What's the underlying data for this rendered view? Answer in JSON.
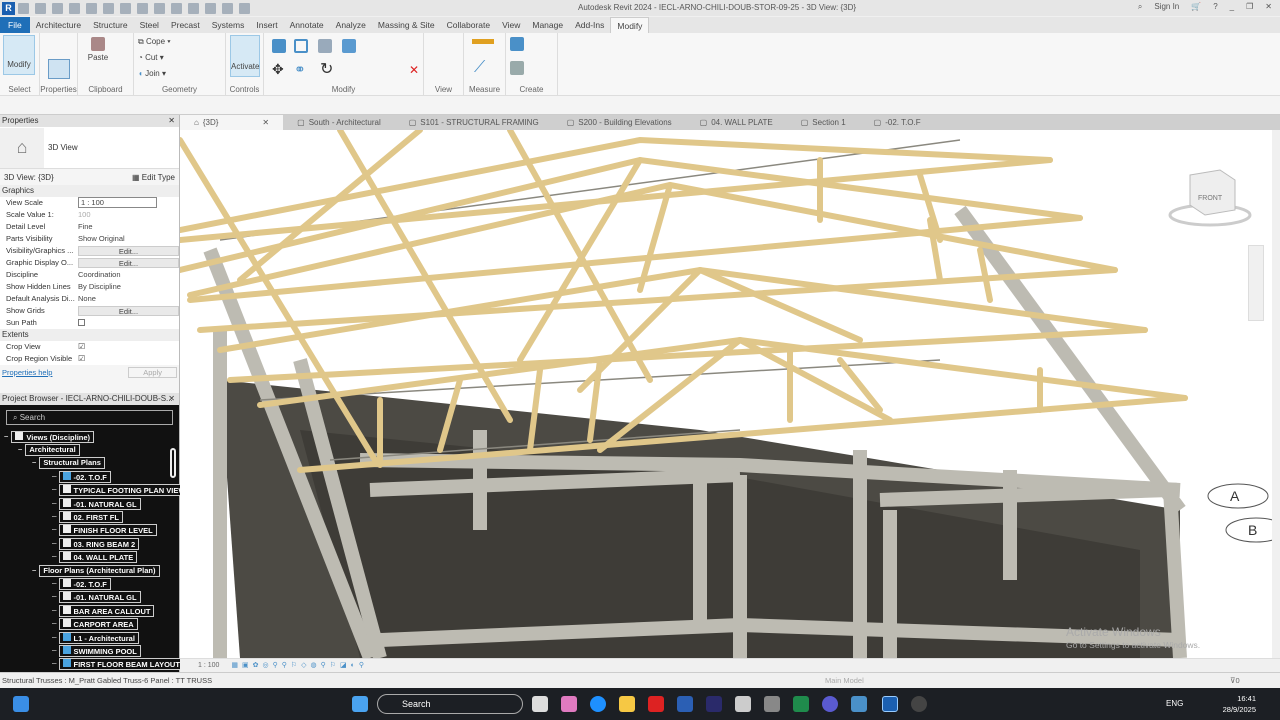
{
  "app": {
    "logo": "R",
    "title": "Autodesk Revit 2024 - IECL-ARNO-CHILI-DOUB-STOR-09-25 - 3D View: {3D}",
    "sign_in": "Sign In"
  },
  "ribbon_tabs": [
    "File",
    "Architecture",
    "Structure",
    "Steel",
    "Precast",
    "Systems",
    "Insert",
    "Annotate",
    "Analyze",
    "Massing & Site",
    "Collaborate",
    "View",
    "Manage",
    "Add-Ins",
    "Modify"
  ],
  "ribbon": {
    "modify": "Modify",
    "paste": "Paste",
    "cope": "Cope",
    "cut": "Cut",
    "join": "Join",
    "activate": "Activate",
    "panels": {
      "select": "Select",
      "properties": "Properties",
      "clipboard": "Clipboard",
      "geometry": "Geometry",
      "controls": "Controls",
      "modify": "Modify",
      "view": "View",
      "measure": "Measure",
      "create": "Create"
    }
  },
  "properties": {
    "header": "Properties",
    "type_name": "3D View",
    "selector": "3D View: {3D}",
    "edit_type": "Edit Type",
    "graphics": "Graphics",
    "extents": "Extents",
    "help": "Properties help",
    "apply": "Apply",
    "rows": [
      [
        "View Scale",
        "1 : 100"
      ],
      [
        "Scale Value    1:",
        "100"
      ],
      [
        "Detail Level",
        "Fine"
      ],
      [
        "Parts Visibility",
        "Show Original"
      ],
      [
        "Visibility/Graphics ...",
        "Edit..."
      ],
      [
        "Graphic Display O...",
        "Edit..."
      ],
      [
        "Discipline",
        "Coordination"
      ],
      [
        "Show Hidden Lines",
        "By Discipline"
      ],
      [
        "Default Analysis Di...",
        "None"
      ],
      [
        "Show Grids",
        "Edit..."
      ],
      [
        "Sun Path",
        ""
      ]
    ],
    "extent_rows": [
      [
        "Crop View",
        "checked"
      ],
      [
        "Crop Region Visible",
        "checked"
      ]
    ]
  },
  "browser": {
    "header": "Project Browser - IECL-ARNO-CHILI-DOUB-S...",
    "search": "Search",
    "nodes": [
      {
        "label": "Views (Discipline)",
        "depth": 0,
        "icon": "folder"
      },
      {
        "label": "Architectural",
        "depth": 1
      },
      {
        "label": "Structural Plans",
        "depth": 2
      },
      {
        "label": "-02. T.O.F",
        "depth": 3,
        "icon": "blue"
      },
      {
        "label": "TYPICAL FOOTING PLAN VIEW",
        "depth": 3,
        "icon": "white"
      },
      {
        "label": "-01. NATURAL GL",
        "depth": 3,
        "icon": "white"
      },
      {
        "label": "02. FIRST FL",
        "depth": 3,
        "icon": "white"
      },
      {
        "label": "FINISH FLOOR LEVEL",
        "depth": 3,
        "icon": "white"
      },
      {
        "label": "03. RING BEAM 2",
        "depth": 3,
        "icon": "white"
      },
      {
        "label": "04. WALL PLATE",
        "depth": 3,
        "icon": "white"
      },
      {
        "label": "Floor Plans (Architectural Plan)",
        "depth": 2
      },
      {
        "label": "-02. T.O.F",
        "depth": 3,
        "icon": "white"
      },
      {
        "label": "-01. NATURAL GL",
        "depth": 3,
        "icon": "white"
      },
      {
        "label": "BAR AREA CALLOUT",
        "depth": 3,
        "icon": "white"
      },
      {
        "label": "CARPORT AREA",
        "depth": 3,
        "icon": "white"
      },
      {
        "label": "L1 - Architectural",
        "depth": 3,
        "icon": "blue"
      },
      {
        "label": "SWIMMING POOL",
        "depth": 3,
        "icon": "blue"
      },
      {
        "label": "FIRST FLOOR BEAM LAYOUT",
        "depth": 3,
        "icon": "blue"
      }
    ]
  },
  "view_tabs": [
    "{3D}",
    "South - Architectural",
    "S101 - STRUCTURAL FRAMING",
    "S200 - Building Elevations",
    "04. WALL PLATE",
    "Section 1",
    "-02. T.O.F"
  ],
  "viewcube": "FRONT",
  "grid_bubbles": [
    "A",
    "B"
  ],
  "view_control": {
    "scale": "1 : 100"
  },
  "status": {
    "text": "Structural Trusses : M_Pratt Gabled Truss-6 Panel : TT TRUSS",
    "model": "Main Model",
    "filter": "0"
  },
  "watermark": {
    "title": "Activate Windows",
    "sub": "Go to Settings to activate Windows."
  },
  "taskbar": {
    "search": "Search",
    "lang": "ENG",
    "time": "16:41",
    "date": "28/9/2025"
  }
}
